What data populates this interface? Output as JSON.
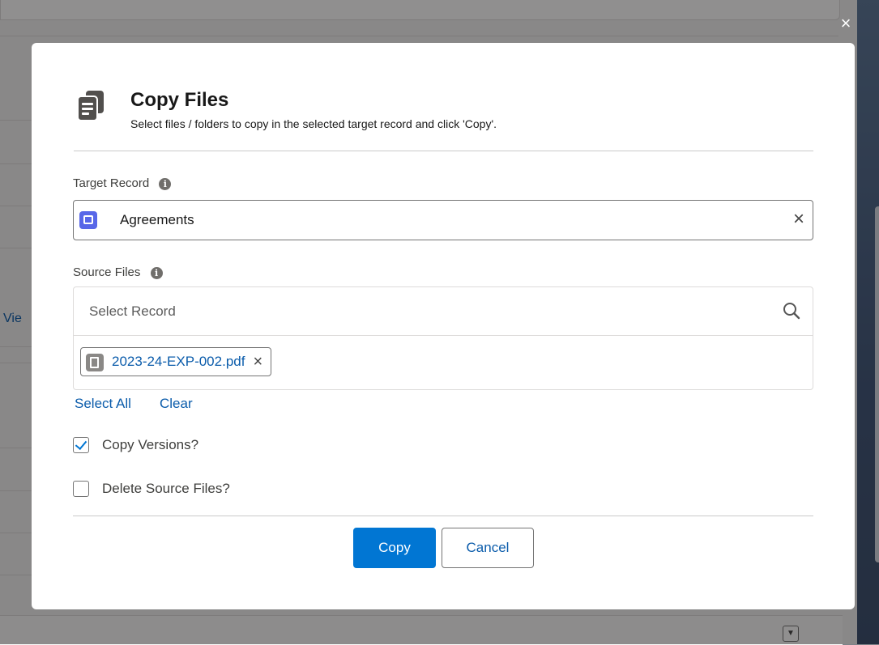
{
  "background": {
    "partial_link_text": "Vie",
    "close_glyph": "×"
  },
  "modal": {
    "icon": "file-list-icon",
    "title": "Copy Files",
    "subtitle": "Select files / folders to copy in the selected target record and click 'Copy'.",
    "target_record": {
      "label": "Target Record",
      "info_glyph": "i",
      "value": "Agreements",
      "value_icon": "folder-icon",
      "clear_glyph": "×"
    },
    "source_files": {
      "label": "Source Files",
      "info_glyph": "i",
      "search_placeholder": "Select Record",
      "selected_files": [
        {
          "name": "2023-24-EXP-002.pdf",
          "icon": "document-icon",
          "remove_glyph": "×"
        }
      ],
      "select_all_label": "Select All",
      "clear_label": "Clear"
    },
    "options": [
      {
        "label": "Copy Versions?",
        "checked": true
      },
      {
        "label": "Delete Source Files?",
        "checked": false
      }
    ],
    "buttons": {
      "copy_label": "Copy",
      "cancel_label": "Cancel"
    }
  },
  "colors": {
    "brand_blue": "#0176d3",
    "link_blue": "#0b5cab",
    "folder_icon_purple": "#5867e8",
    "overlay": "#080707"
  }
}
